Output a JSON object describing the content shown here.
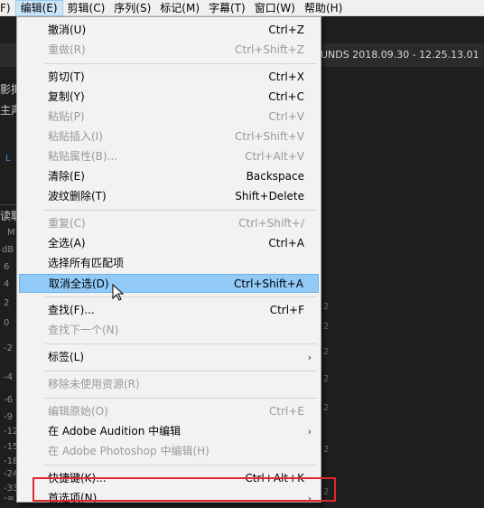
{
  "menubar": {
    "items": [
      {
        "label": "F)",
        "active": false
      },
      {
        "label": "编辑(E)",
        "active": true
      },
      {
        "label": "剪辑(C)",
        "active": false
      },
      {
        "label": "序列(S)",
        "active": false
      },
      {
        "label": "标记(M)",
        "active": false
      },
      {
        "label": "字幕(T)",
        "active": false
      },
      {
        "label": "窗口(W)",
        "active": false
      },
      {
        "label": "帮助(H)",
        "active": false
      }
    ]
  },
  "background": {
    "sequence_title": "UNDS 2018.09.30 - 12.25.13.01",
    "left_texts": [
      "影拟",
      "主声",
      "L",
      "读取",
      "M",
      "dB"
    ],
    "scale_numbers": [
      "6",
      "4",
      "2",
      "0",
      "-2",
      "-4",
      "-6",
      "-9",
      "-12",
      "-15",
      "-18",
      "-24",
      "-33",
      "-∞"
    ],
    "right_numbers": [
      "2",
      "2",
      "2",
      "2",
      "2",
      "2",
      "2"
    ]
  },
  "menu": {
    "items": [
      {
        "type": "item",
        "label": "撤消(U)",
        "shortcut": "Ctrl+Z",
        "disabled": false
      },
      {
        "type": "item",
        "label": "重做(R)",
        "shortcut": "Ctrl+Shift+Z",
        "disabled": true
      },
      {
        "type": "sep"
      },
      {
        "type": "item",
        "label": "剪切(T)",
        "shortcut": "Ctrl+X",
        "disabled": false
      },
      {
        "type": "item",
        "label": "复制(Y)",
        "shortcut": "Ctrl+C",
        "disabled": false
      },
      {
        "type": "item",
        "label": "粘贴(P)",
        "shortcut": "Ctrl+V",
        "disabled": true
      },
      {
        "type": "item",
        "label": "粘贴插入(I)",
        "shortcut": "Ctrl+Shift+V",
        "disabled": true
      },
      {
        "type": "item",
        "label": "粘贴属性(B)...",
        "shortcut": "Ctrl+Alt+V",
        "disabled": true
      },
      {
        "type": "item",
        "label": "清除(E)",
        "shortcut": "Backspace",
        "disabled": false
      },
      {
        "type": "item",
        "label": "波纹删除(T)",
        "shortcut": "Shift+Delete",
        "disabled": false
      },
      {
        "type": "sep"
      },
      {
        "type": "item",
        "label": "重复(C)",
        "shortcut": "Ctrl+Shift+/",
        "disabled": true
      },
      {
        "type": "item",
        "label": "全选(A)",
        "shortcut": "Ctrl+A",
        "disabled": false
      },
      {
        "type": "item",
        "label": "选择所有匹配项",
        "shortcut": "",
        "disabled": false
      },
      {
        "type": "item",
        "label": "取消全选(D)",
        "shortcut": "Ctrl+Shift+A",
        "disabled": false,
        "highlight": true
      },
      {
        "type": "sep"
      },
      {
        "type": "item",
        "label": "查找(F)...",
        "shortcut": "Ctrl+F",
        "disabled": false
      },
      {
        "type": "item",
        "label": "查找下一个(N)",
        "shortcut": "",
        "disabled": true
      },
      {
        "type": "sep"
      },
      {
        "type": "item",
        "label": "标签(L)",
        "shortcut": "",
        "disabled": false,
        "submenu": true
      },
      {
        "type": "sep"
      },
      {
        "type": "item",
        "label": "移除未使用资源(R)",
        "shortcut": "",
        "disabled": true
      },
      {
        "type": "sep"
      },
      {
        "type": "item",
        "label": "编辑原始(O)",
        "shortcut": "Ctrl+E",
        "disabled": true
      },
      {
        "type": "item",
        "label": "在 Adobe Audition 中编辑",
        "shortcut": "",
        "disabled": false,
        "submenu": true
      },
      {
        "type": "item",
        "label": "在 Adobe Photoshop 中编辑(H)",
        "shortcut": "",
        "disabled": true
      },
      {
        "type": "sep"
      },
      {
        "type": "item",
        "label": "快捷键(K)...",
        "shortcut": "Ctrl+Alt+K",
        "disabled": false
      },
      {
        "type": "item",
        "label": "首选项(N)",
        "shortcut": "",
        "disabled": false,
        "submenu": true,
        "outlined": true
      }
    ],
    "submenu_arrow": "›"
  },
  "colors": {
    "highlight_bg": "#91c9f7",
    "outline_red": "#e0282e",
    "menubar_active": "#cce4f7"
  },
  "icons": {
    "cursor": "arrow-pointer-icon",
    "submenu": "chevron-right-icon"
  }
}
